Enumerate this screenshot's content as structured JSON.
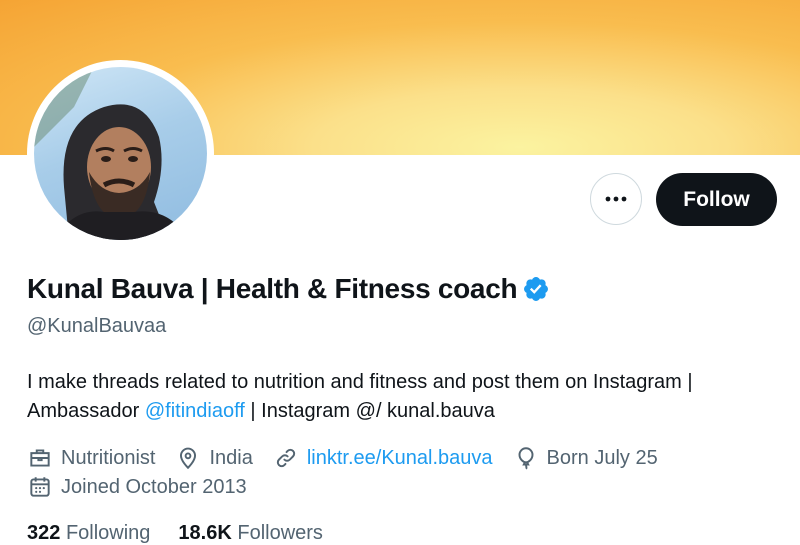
{
  "profile": {
    "name": "Kunal Bauva | Health & Fitness coach",
    "handle": "@KunalBauvaa",
    "bio_part1": "I make threads related to nutrition and fitness and post them on Instagram | Ambassador ",
    "bio_mention": "@fitindiaoff",
    "bio_part2": " | Instagram @/ kunal.bauva",
    "verified": true
  },
  "actions": {
    "more_icon": "more-horizontal-icon",
    "follow_label": "Follow"
  },
  "meta": {
    "profession": "Nutritionist",
    "location": "India",
    "website": "linktr.ee/Kunal.bauva",
    "birthday": "Born July 25",
    "joined": "Joined October 2013"
  },
  "stats": {
    "following_count": "322",
    "following_label": "Following",
    "followers_count": "18.6K",
    "followers_label": "Followers"
  },
  "colors": {
    "accent": "#1d9bf0",
    "text": "#0f1419",
    "secondary": "#536471",
    "follow_bg": "#0f1419"
  }
}
